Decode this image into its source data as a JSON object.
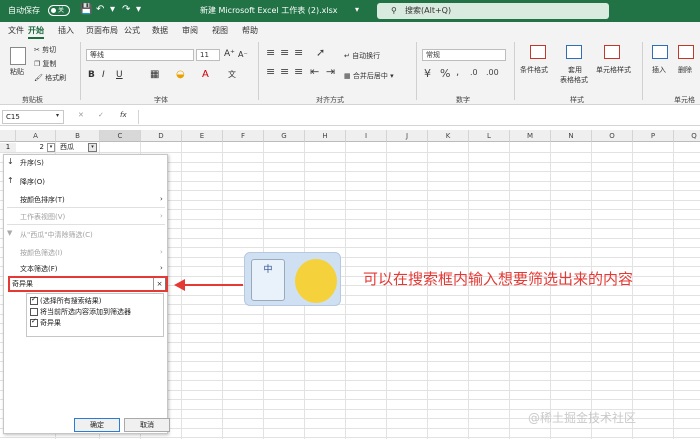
{
  "titlebar": {
    "autosave_label": "自动保存",
    "autosave_state": "关",
    "doc_title": "新建 Microsoft Excel 工作表 (2).xlsx",
    "search_placeholder": "搜索(Alt+Q)"
  },
  "tabs": [
    "文件",
    "开始",
    "插入",
    "页面布局",
    "公式",
    "数据",
    "审阅",
    "视图",
    "帮助"
  ],
  "active_tab": "开始",
  "ribbon": {
    "clipboard": {
      "paste": "粘贴",
      "cut": "剪切",
      "copy": "复制",
      "format_painter": "格式刷",
      "group": "剪贴板"
    },
    "font": {
      "name": "等线",
      "size": "11",
      "bold": "B",
      "italic": "I",
      "underline": "U",
      "group": "字体"
    },
    "alignment": {
      "wrap": "自动换行",
      "merge": "合并后居中",
      "group": "对齐方式"
    },
    "number": {
      "format": "常规",
      "group": "数字"
    },
    "styles": {
      "cond": "条件格式",
      "table_1": "套用",
      "table_2": "表格格式",
      "cell_styles": "单元格样式",
      "group": "样式"
    },
    "cells": {
      "insert": "插入",
      "delete": "删除",
      "group": "单元格"
    }
  },
  "formula_bar": {
    "name_box": "C15",
    "fx": "fx"
  },
  "grid": {
    "columns": [
      "A",
      "B",
      "C",
      "D",
      "E",
      "F",
      "G",
      "H",
      "I",
      "J",
      "K",
      "L",
      "M",
      "N",
      "O",
      "P",
      "Q"
    ],
    "row1_num": "1",
    "a1_value": "2",
    "b1_value": "西瓜"
  },
  "filter_panel": {
    "sort_asc": "升序(S)",
    "sort_desc": "降序(O)",
    "sort_by_color": "按颜色排序(T)",
    "sheet_view": "工作表视图(V)",
    "clear_filter": "从\"西瓜\"中清除筛选(C)",
    "filter_by_color": "按颜色筛选(I)",
    "text_filter": "文本筛选(F)",
    "search_value": "奇异果",
    "clear_icon": "×",
    "options": [
      {
        "label": "(选择所有搜索结果)",
        "checked": true
      },
      {
        "label": "将当前所选内容添加到筛选器",
        "checked": false
      },
      {
        "label": "奇异果",
        "checked": true
      }
    ],
    "ok": "确定",
    "cancel": "取消"
  },
  "annotation": "可以在搜索框内输入想要筛选出来的内容",
  "sticker_text": "中",
  "watermark": "@稀土掘金技术社区",
  "colors": {
    "excel_green": "#217346",
    "annotation_red": "#e53935"
  }
}
